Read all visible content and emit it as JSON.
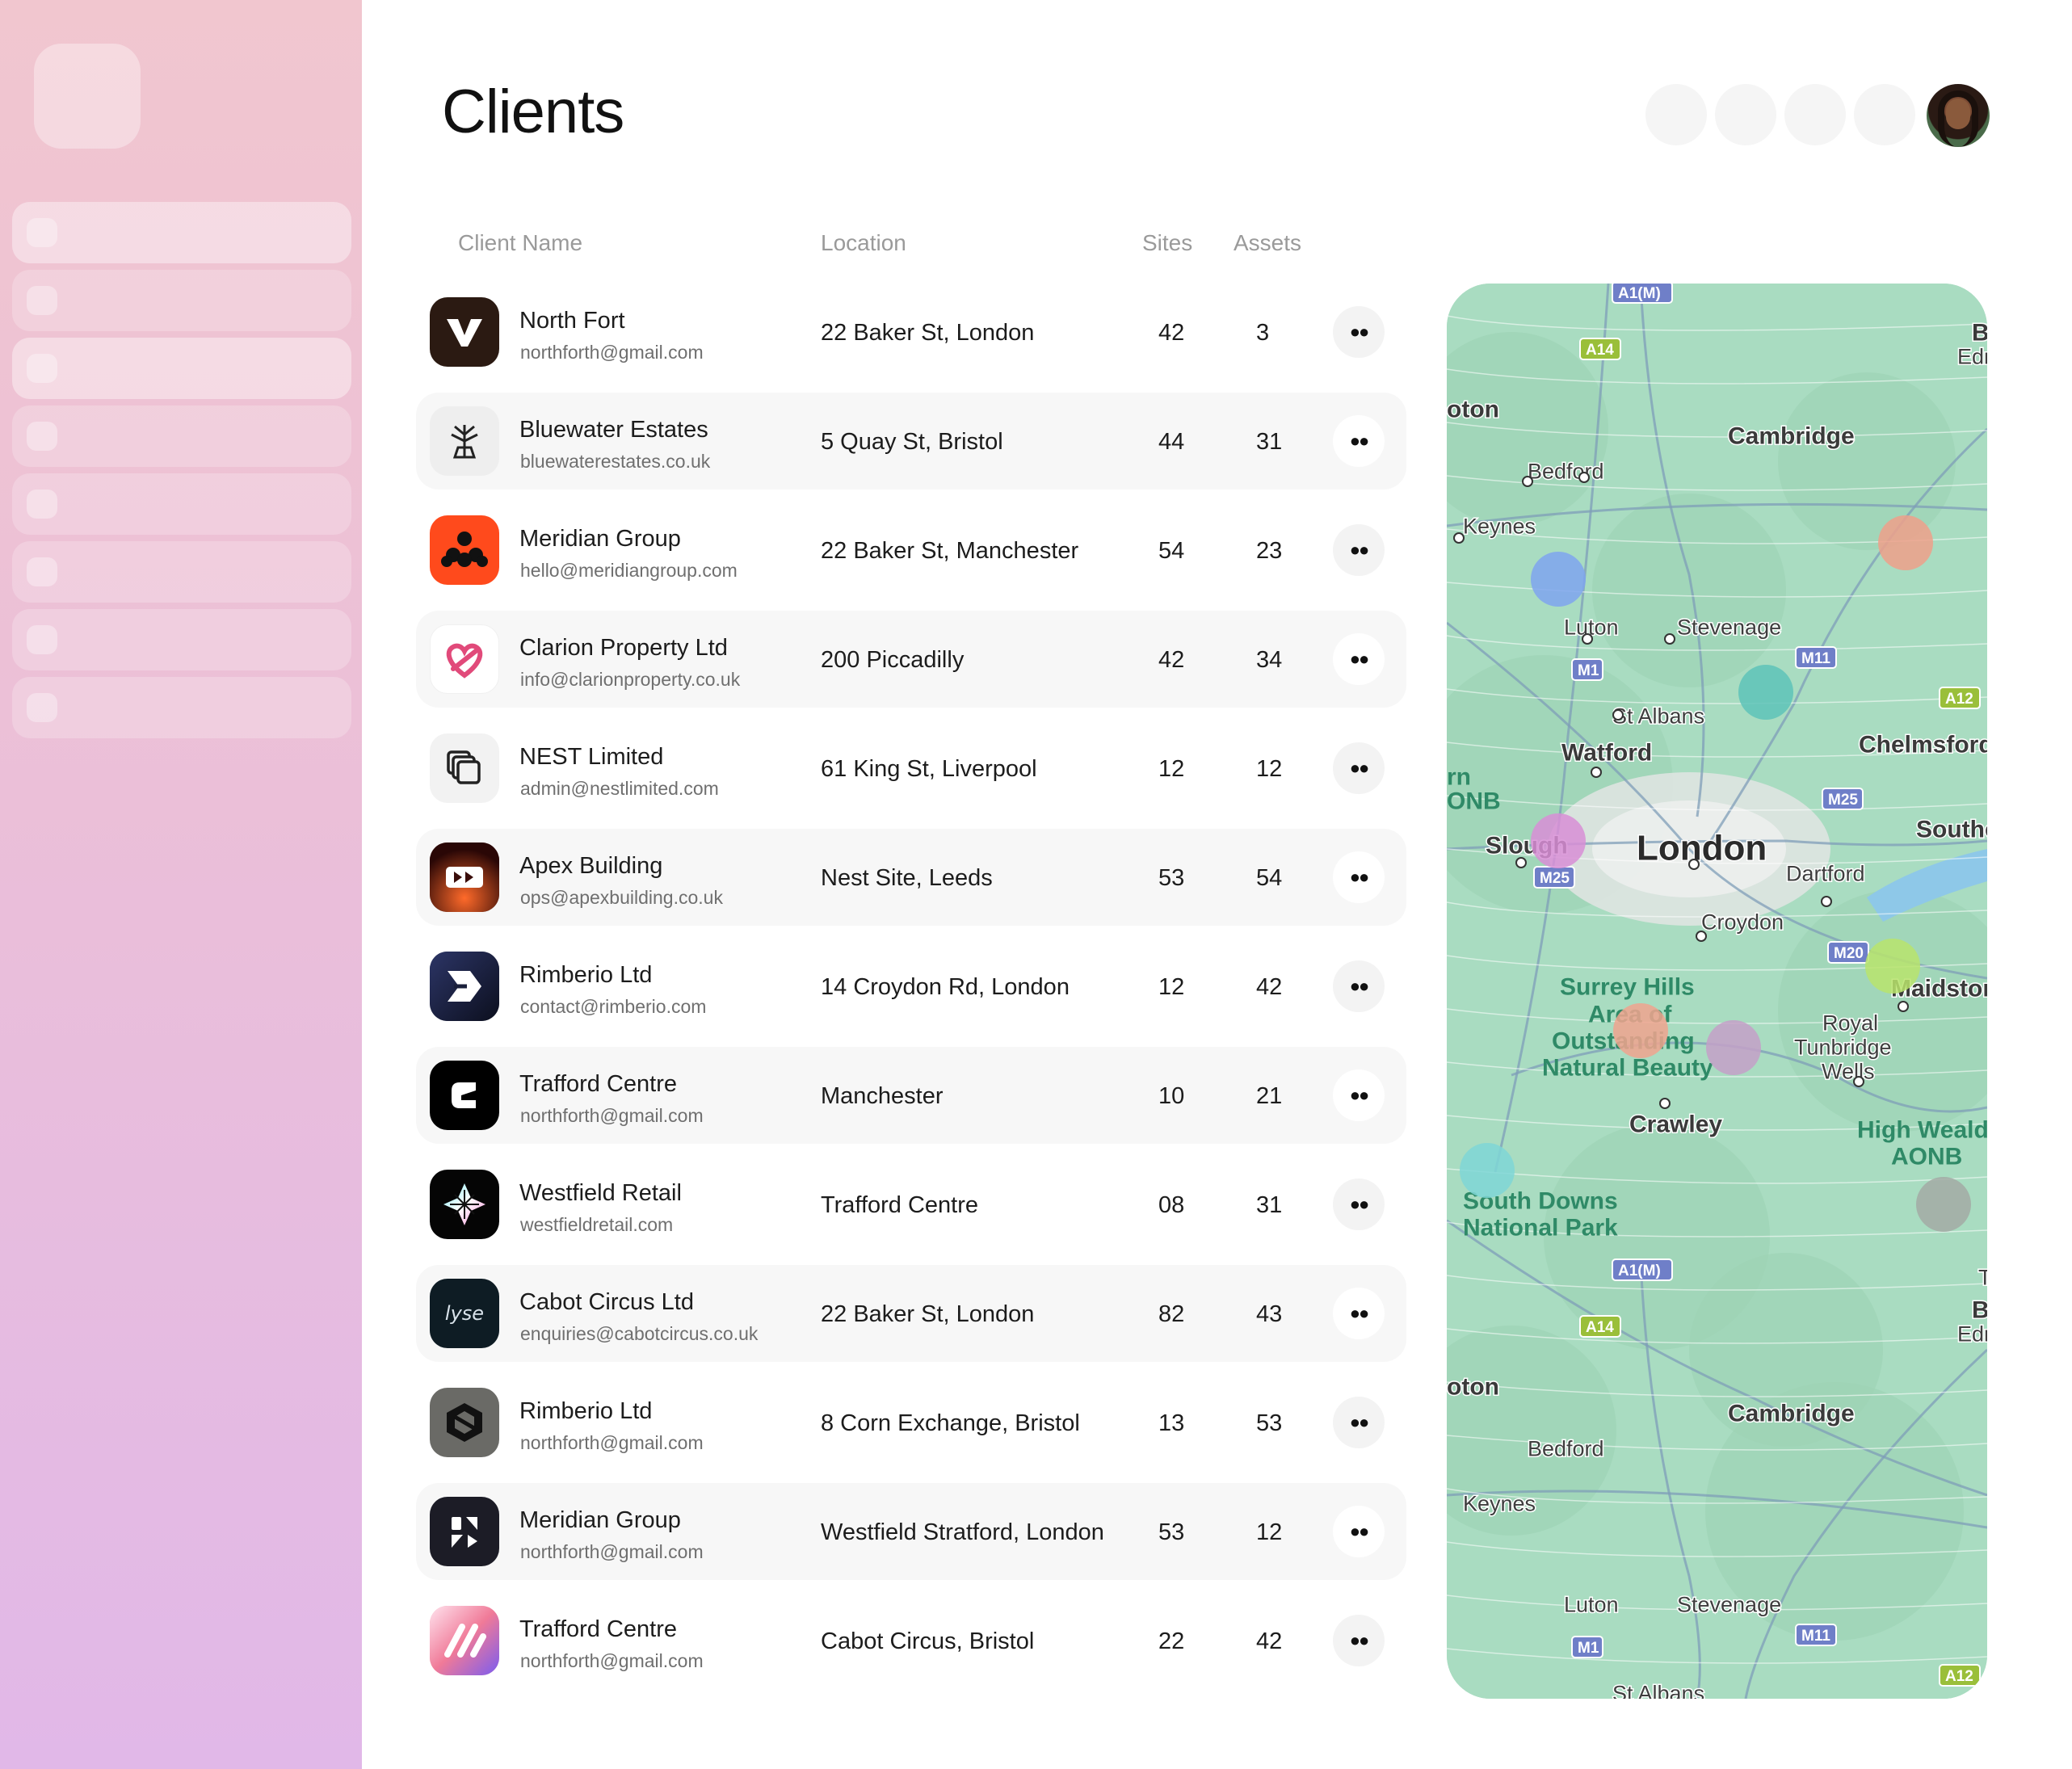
{
  "page": {
    "title": "Clients"
  },
  "columns": {
    "name": "Client Name",
    "location": "Location",
    "sites": "Sites",
    "assets": "Assets"
  },
  "clients": [
    {
      "name": "North Fort",
      "email": "northforth@gmail.com",
      "location": "22 Baker St, London",
      "sites": "42",
      "assets": "3",
      "icon": "v-logo-icon",
      "bg": "#2b1a12"
    },
    {
      "name": "Bluewater Estates",
      "email": "bluewaterestates.co.uk",
      "location": "5 Quay St, Bristol",
      "sites": "44",
      "assets": "31",
      "icon": "tree-icon",
      "bg": "#eeeeee"
    },
    {
      "name": "Meridian Group",
      "email": "hello@meridiangroup.com",
      "location": "22 Baker St, Manchester",
      "sites": "54",
      "assets": "23",
      "icon": "dots-cluster-icon",
      "bg": "#ff4a1c"
    },
    {
      "name": "Clarion Property Ltd",
      "email": "info@clarionproperty.co.uk",
      "location": "200 Piccadilly",
      "sites": "42",
      "assets": "34",
      "icon": "heart-knot-icon",
      "bg": "#ffffff"
    },
    {
      "name": "NEST Limited",
      "email": "admin@nestlimited.com",
      "location": "61 King St, Liverpool",
      "sites": "12",
      "assets": "12",
      "icon": "stacked-squares-icon",
      "bg": "#f2f2f2"
    },
    {
      "name": "Apex Building",
      "email": "ops@apexbuilding.co.uk",
      "location": "Nest Site, Leeds",
      "sites": "53",
      "assets": "54",
      "icon": "play-forward-icon",
      "bg": "#3a0d0a"
    },
    {
      "name": "Rimberio Ltd",
      "email": "contact@rimberio.com",
      "location": "14 Croydon Rd, London",
      "sites": "12",
      "assets": "42",
      "icon": "arrow-mark-icon",
      "bg": "#1a1f3a"
    },
    {
      "name": "Trafford Centre",
      "email": "northforth@gmail.com",
      "location": "Manchester",
      "sites": "10",
      "assets": "21",
      "icon": "c-shape-icon",
      "bg": "#000000"
    },
    {
      "name": "Westfield Retail",
      "email": "westfieldretail.com",
      "location": "Trafford Centre",
      "sites": "08",
      "assets": "31",
      "icon": "star-burst-icon",
      "bg": "#050505"
    },
    {
      "name": "Cabot Circus Ltd",
      "email": "enquiries@cabotcircus.co.uk",
      "location": "22 Baker St, London",
      "sites": "82",
      "assets": "43",
      "icon": "lyse-wordmark-icon",
      "bg": "#0e1c24",
      "logo_text": "lyse"
    },
    {
      "name": "Rimberio Ltd",
      "email": "northforth@gmail.com",
      "location": "8 Corn Exchange, Bristol",
      "sites": "13",
      "assets": "53",
      "icon": "hexagon-icon",
      "bg": "#6a6a66"
    },
    {
      "name": "Meridian Group",
      "email": "northforth@gmail.com",
      "location": "Westfield Stratford, London",
      "sites": "53",
      "assets": "12",
      "icon": "split-shapes-icon",
      "bg": "#1c1c26"
    },
    {
      "name": "Trafford Centre",
      "email": "northforth@gmail.com",
      "location": "Cabot Circus, Bristol",
      "sites": "22",
      "assets": "42",
      "icon": "gradient-lines-icon",
      "bg": "#f08aa0"
    }
  ],
  "row_action": {
    "icon": "more-dots-icon"
  },
  "map": {
    "labels": [
      "A1(M)",
      "A14",
      "Cambridge",
      "Bedford",
      "Keynes",
      "Luton",
      "Stevenage",
      "M1",
      "M11",
      "A12",
      "St Albans",
      "Watford",
      "Chelmsford",
      "M25",
      "Southe",
      "Slough",
      "London",
      "Dartford",
      "M25",
      "Croydon",
      "M20",
      "Surrey Hills",
      "Area of",
      "Outstanding",
      "Natural Beauty",
      "Maidstone",
      "Royal",
      "Tunbridge",
      "Wells",
      "Crawley",
      "High Weald",
      "AONB",
      "South Downs",
      "National Park",
      "Bu",
      "Edn",
      "oton",
      "rn",
      "ONB",
      "T",
      "A1(M)",
      "A14",
      "Cambridge",
      "Bedford",
      "Keynes",
      "Luton",
      "Stevenage",
      "M1",
      "M11",
      "A12",
      "St Albans",
      "oton",
      "Bu",
      "Edn"
    ],
    "markers": [
      {
        "name": "marker-blue",
        "color": "#7fa4ef"
      },
      {
        "name": "marker-orange",
        "color": "#eea08a"
      },
      {
        "name": "marker-teal",
        "color": "#5ec3b8"
      },
      {
        "name": "marker-magenta",
        "color": "#d88ed6"
      },
      {
        "name": "marker-lime",
        "color": "#b8e46c"
      },
      {
        "name": "marker-salmon",
        "color": "#f0a38e"
      },
      {
        "name": "marker-mauve",
        "color": "#c4a0c8"
      },
      {
        "name": "marker-cyan",
        "color": "#7fd6d6"
      },
      {
        "name": "marker-grey",
        "color": "#a3aaa4"
      }
    ]
  }
}
